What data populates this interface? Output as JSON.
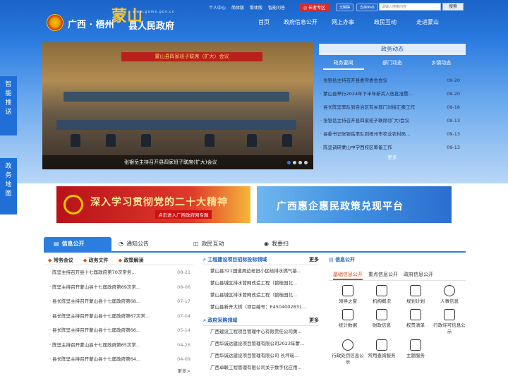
{
  "header": {
    "logo_region": "广西 · 梧州",
    "logo_county": "蒙山",
    "logo_suffix": "县人民政府",
    "url": "www.gxms.gov.cn",
    "top_links": [
      "个人中心",
      "简体版",
      "繁体版",
      "智能问答"
    ],
    "elder_zone": "长者专区",
    "accessibility": [
      "无障碍",
      "支持IPv6"
    ],
    "search_placeholder": "请输入搜索内容",
    "search_button": "搜索",
    "nav": [
      "首页",
      "政府信息公开",
      "网上办事",
      "政民互动",
      "走进蒙山"
    ]
  },
  "slider": {
    "banner": "蒙山县四家班子联席（扩大）会议",
    "caption": "张银岳主持召开县四家班子联席(扩大)会议",
    "active_dot": 0
  },
  "side_tabs": [
    "智能推送",
    "政务地图"
  ],
  "news": {
    "title": "政务动态",
    "tabs": [
      "政务要闻",
      "部门动态",
      "乡镇动态"
    ],
    "items": [
      {
        "title": "张银岳主持召开县委常委会会议",
        "date": "09-20"
      },
      {
        "title": "蒙山县举行2024年下半年新兵入伍批准暨...",
        "date": "09-20"
      },
      {
        "title": "县长陈坚率队到自治区有关部门对接汇报工作",
        "date": "09-18"
      },
      {
        "title": "张银岳主持召开县四家班子联席(扩大)会议",
        "date": "09-13"
      },
      {
        "title": "县委书记张银岳率队到梧州市农业农村局...",
        "date": "09-13"
      },
      {
        "title": "陈坚调研蒙山中学西校区筹备工作",
        "date": "09-13"
      }
    ],
    "more": "更多"
  },
  "banners": {
    "left_main": "深入学习贯彻党的二十大精神",
    "left_sub": "点击进入广西政府网专题",
    "right_main": "广西惠企惠民政策兑现平台"
  },
  "main_tabs": [
    "信息公开",
    "通知公告",
    "政民互动",
    "我要扫"
  ],
  "left_col": {
    "subtabs": [
      "常务会议",
      "政务文件",
      "政策解读"
    ],
    "items": [
      {
        "title": "陈坚主持召开县十七届政府第70次常务...",
        "date": "08-21"
      },
      {
        "title": "陈坚主持召开蒙山县十七届政府第69次常...",
        "date": "08-06"
      },
      {
        "title": "县长陈坚主持召开蒙山县十七届政府第68...",
        "date": "07-17"
      },
      {
        "title": "县长陈坚主持召开蒙山县十七届政府第67次常...",
        "date": "07-04"
      },
      {
        "title": "县长陈坚主持召开蒙山县十七届政府第66...",
        "date": "05-14"
      },
      {
        "title": "陈坚主持召开蒙山县十七届政府第65次常...",
        "date": "04-26"
      },
      {
        "title": "县长陈坚主持召开蒙山县十七届政府第64...",
        "date": "04-09"
      }
    ],
    "more": "更多>"
  },
  "mid_col": {
    "section1": {
      "title": "工程建设项目招标投标领域",
      "more": "更多",
      "items": [
        "蒙山县321国道周边老旧小区给排水燃气基...",
        "蒙山县城区排水管网改造工程（碧桂园北...",
        "蒙山县城区排水管网改造工程（碧桂园北...",
        "蒙山县新开大桥（项目编号：E4504002831..."
      ]
    },
    "section2": {
      "title": "政府采购领域",
      "more": "更多",
      "items": [
        "广西建设工程项目管理中心有限责任公司黄...",
        "广西华诚达建设项目管理有限公司2023年蒙...",
        "广西华诚达建设项目管理有限公司 长坪瑶...",
        "广西卓联工程管理有限公司关于数字化应用..."
      ]
    }
  },
  "right_col": {
    "title": "信息公开",
    "tabs": [
      "基础信息公开",
      "重点信息公开",
      "政府信息公开"
    ],
    "items": [
      "领导之窗",
      "机构概况",
      "规划计划",
      "人事信息",
      "统计数据",
      "财政信息",
      "权责清单",
      "行政许可信息公示",
      "行政处罚信息公示",
      "常用查询服务",
      "主题服务"
    ]
  }
}
